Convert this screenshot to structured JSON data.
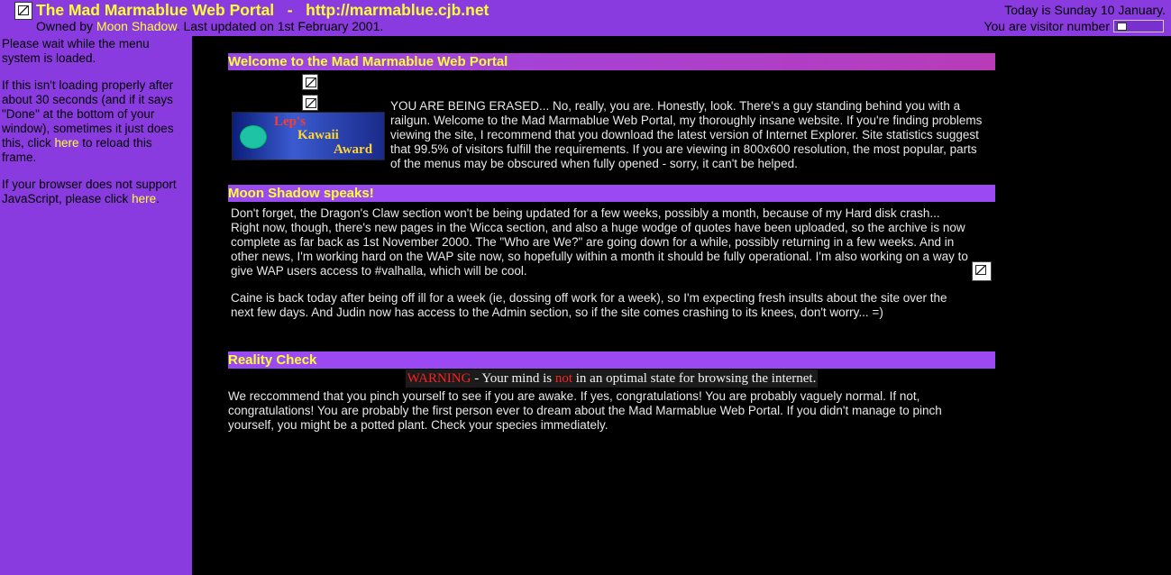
{
  "header": {
    "title": "The Mad Marmablue Web Portal   -   http://marmablue.cjb.net",
    "owner_prefix": "Owned by ",
    "owner_name": "Moon Shadow",
    "owner_suffix": ". Last updated on 1st February 2001.",
    "today": "Today is Sunday 10 January.",
    "visitor": "You are visitor number"
  },
  "sidebar": {
    "p1": "Please wait while the menu system is loaded.",
    "p2_before": "If this isn't loading properly after about 30 seconds (and if it says \"Done\" at the bottom of your window), sometimes it just does this, click ",
    "p2_link": "here",
    "p2_after": " to reload this frame.",
    "p3_before": "If your browser does not support JavaScript, please click ",
    "p3_link": "here",
    "p3_after": "."
  },
  "welcome": {
    "heading": "Welcome to the Mad Marmablue Web Portal",
    "award_line1": "Lep's",
    "award_line2": "Kawaii",
    "award_line3": "Award",
    "body": "YOU ARE BEING ERASED... No, really, you are. Honestly, look. There's a guy standing behind you with a railgun. Welcome to the Mad Marmablue Web Portal, my thoroughly insane website. If you're finding problems viewing the site, I recommend that you download the latest version of Internet Explorer. Site statistics suggest that 99.5% of visitors fulfill the requirements. If you are viewing in 800x600 resolution, the most popular, parts of the menus may be obscured when fully opened - sorry, it can't be helped."
  },
  "speaks": {
    "heading": "Moon Shadow speaks!",
    "p1": "Don't forget, the Dragon's Claw section won't be being updated for a few weeks, possibly a month, because of my Hard disk crash... Right now, though, there's new pages in the Wicca section, and also a huge wodge of quotes have been uploaded, so the archive is now complete as far back as 1st November 2000. The \"Who are We?\" are going down for a while, possibly returning in a few weeks. And in other news, I'm working hard on the WAP site now, so hopefully within a month it should be fully operational. I'm also working on a way to give WAP users access to #valhalla, which will be cool.",
    "p2": "Caine is back today after being off ill for a week (ie, dossing off work for a week), so I'm expecting fresh insults about the site over the next few days. And Judin now has access to the Admin section, so if the site comes crashing to its knees, don't worry... =)"
  },
  "reality": {
    "heading": "Reality Check",
    "warn_label": "WARNING",
    "warn_mid": " - Your mind is ",
    "warn_not": "not",
    "warn_end": " in an optimal state for browsing the internet.",
    "body": "We reccommend that you pinch yourself to see if you are awake. If yes, congratulations! You are probably vaguely normal. If not, congratulations! You are probably the first person ever to dream about the Mad Marmablue Web Portal. If you didn't manage to pinch yourself, you might be a potted plant. Check your species immediately."
  },
  "colors": {
    "frame_purple": "#8a3be0",
    "heading_yellow": "#ffff33",
    "warning_red": "#ff2020"
  }
}
